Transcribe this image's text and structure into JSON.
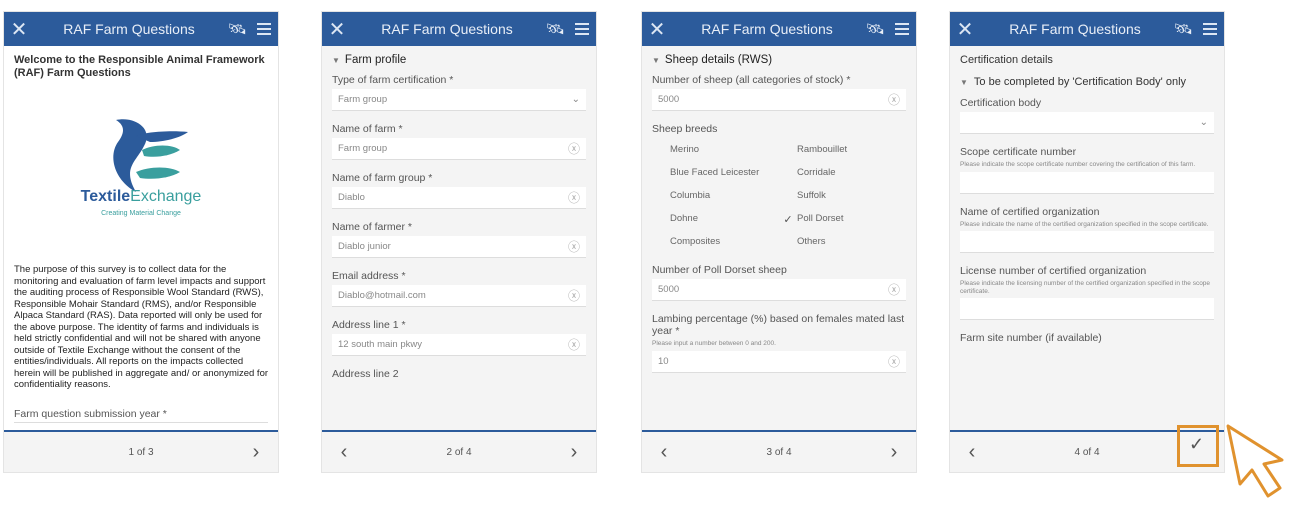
{
  "app_title": "RAF Farm Questions",
  "colors": {
    "header": "#2c5b9b",
    "accent": "#e0922e",
    "teal": "#3a9f9e"
  },
  "icons": {
    "close": "close-icon",
    "satellite": "satellite-icon",
    "menu": "hamburger-menu-icon",
    "prev": "chevron-left-icon",
    "next": "chevron-right-icon",
    "clear": "clear-circle-icon",
    "dropdown": "chevron-down-icon",
    "submit": "checkmark-icon",
    "cursor": "pointer-cursor-icon"
  },
  "screen1": {
    "welcome": "Welcome to the Responsible Animal Framework (RAF) Farm Questions",
    "logo_text_a": "Textile",
    "logo_text_b": "Exchange",
    "logo_tagline": "Creating Material Change",
    "purpose": "The purpose of this survey is to collect data for the monitoring and evaluation of farm level impacts and support the auditing process of Responsible Wool Standard (RWS), Responsible Mohair Standard (RMS), and/or Responsible Alpaca Standard (RAS). Data reported will only be used for the above purpose. The identity of farms and individuals is held strictly confidential and will not be shared with anyone outside of Textile Exchange without the consent of the entities/individuals. All reports on the impacts collected herein will be published in aggregate and/ or anonymized for confidentiality reasons.",
    "submission_year_label": "Farm question submission year *",
    "page": "1 of 3"
  },
  "screen2": {
    "section": "Farm profile",
    "fields": [
      {
        "label": "Type of farm certification *",
        "value": "Farm group"
      },
      {
        "label": "Name of farm *",
        "value": "Farm group"
      },
      {
        "label": "Name of farm group *",
        "value": "Diablo"
      },
      {
        "label": "Name of farmer *",
        "value": "Diablo junior"
      },
      {
        "label": "Email address *",
        "value": "Diablo@hotmail.com"
      },
      {
        "label": "Address line 1 *",
        "value": "12 south main pkwy"
      },
      {
        "label": "Address line 2",
        "value": ""
      }
    ],
    "page": "2 of 4"
  },
  "screen3": {
    "section": "Sheep details (RWS)",
    "num_sheep_label": "Number of sheep (all categories of stock) *",
    "num_sheep_value": "5000",
    "breeds_label": "Sheep breeds",
    "breeds": [
      {
        "name": "Merino",
        "checked": false
      },
      {
        "name": "Rambouillet",
        "checked": false
      },
      {
        "name": "Blue Faced Leicester",
        "checked": false
      },
      {
        "name": "Corridale",
        "checked": false
      },
      {
        "name": "Columbia",
        "checked": false
      },
      {
        "name": "Suffolk",
        "checked": false
      },
      {
        "name": "Dohne",
        "checked": false
      },
      {
        "name": "Poll Dorset",
        "checked": true
      },
      {
        "name": "Composites",
        "checked": false
      },
      {
        "name": "Others",
        "checked": false
      }
    ],
    "poll_dorset_label": "Number of Poll Dorset sheep",
    "poll_dorset_value": "5000",
    "lambing_label": "Lambing percentage (%) based on females mated last year *",
    "lambing_hint": "Please input a number between 0 and 200.",
    "lambing_value": "10",
    "page": "3 of 4"
  },
  "screen4": {
    "title": "Certification details",
    "sub": "To be completed by 'Certification Body' only",
    "cert_body_label": "Certification body",
    "scope_label": "Scope certificate number",
    "scope_hint": "Please indicate the scope certificate number covering the certification of this farm.",
    "org_label": "Name of certified organization",
    "org_hint": "Please indicate the name of the certified organization specified in the scope certificate.",
    "license_label": "License number of certified organization",
    "license_hint": "Please indicate the licensing number of the certified organization specified in the scope certificate.",
    "site_label": "Farm site number (if available)",
    "page": "4 of 4"
  }
}
